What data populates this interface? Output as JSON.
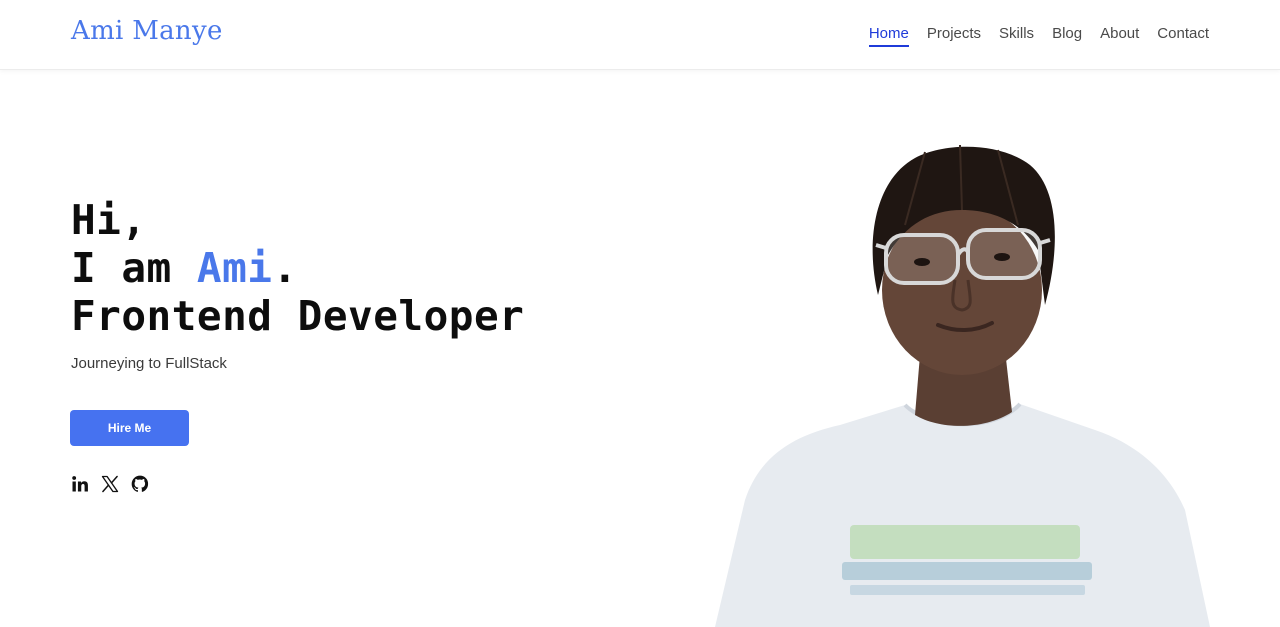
{
  "brand": {
    "name": "Ami Manye",
    "color": "#4a78ea"
  },
  "nav": {
    "items": [
      {
        "label": "Home",
        "active": true
      },
      {
        "label": "Projects",
        "active": false
      },
      {
        "label": "Skills",
        "active": false
      },
      {
        "label": "Blog",
        "active": false
      },
      {
        "label": "About",
        "active": false
      },
      {
        "label": "Contact",
        "active": false
      }
    ]
  },
  "hero": {
    "line1": "Hi,",
    "line2_prefix": "I am ",
    "line2_name": "Ami",
    "line2_suffix": ".",
    "line3": "Frontend Developer",
    "subtitle": "Journeying to FullStack",
    "cta_label": "Hire Me"
  },
  "socials": [
    {
      "icon": "linkedin-icon"
    },
    {
      "icon": "x-icon"
    },
    {
      "icon": "github-icon"
    }
  ],
  "colors": {
    "accent": "#4a78ea",
    "button": "#4672f0",
    "active_nav": "#1f3bd9"
  }
}
